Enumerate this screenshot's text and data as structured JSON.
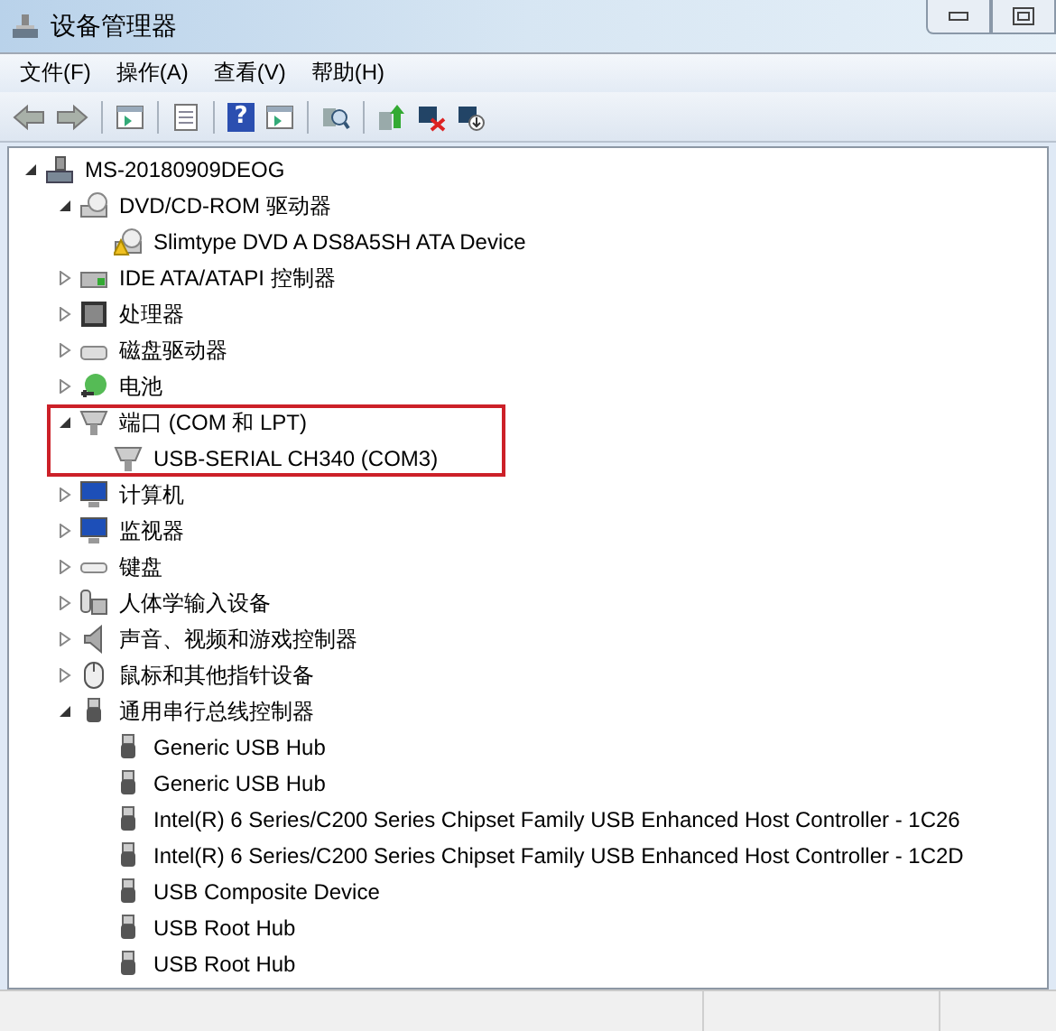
{
  "window": {
    "title": "设备管理器"
  },
  "menu": [
    {
      "label": "文件(F)"
    },
    {
      "label": "操作(A)"
    },
    {
      "label": "查看(V)"
    },
    {
      "label": "帮助(H)"
    }
  ],
  "toolbar": [
    {
      "kind": "back"
    },
    {
      "kind": "forward"
    },
    {
      "kind": "separator"
    },
    {
      "kind": "console-tree"
    },
    {
      "kind": "separator"
    },
    {
      "kind": "properties"
    },
    {
      "kind": "separator"
    },
    {
      "kind": "help",
      "glyph": "?"
    },
    {
      "kind": "action-pane"
    },
    {
      "kind": "separator"
    },
    {
      "kind": "scan"
    },
    {
      "kind": "separator"
    },
    {
      "kind": "update"
    },
    {
      "kind": "disable"
    },
    {
      "kind": "uninstall"
    }
  ],
  "tree": {
    "label": "MS-20180909DEOG",
    "kind": "computer",
    "expanded": true,
    "children": [
      {
        "label": "DVD/CD-ROM 驱动器",
        "kind": "dvd",
        "expanded": true,
        "children": [
          {
            "label": "Slimtype DVD A  DS8A5SH ATA Device",
            "kind": "dvd-warning"
          }
        ]
      },
      {
        "label": "IDE ATA/ATAPI 控制器",
        "kind": "ide",
        "expanded": false
      },
      {
        "label": "处理器",
        "kind": "cpu",
        "expanded": false
      },
      {
        "label": "磁盘驱动器",
        "kind": "disk",
        "expanded": false
      },
      {
        "label": "电池",
        "kind": "battery",
        "expanded": false
      },
      {
        "label": "端口 (COM 和 LPT)",
        "kind": "port",
        "expanded": true,
        "highlight": true,
        "children": [
          {
            "label": "USB-SERIAL CH340 (COM3)",
            "kind": "port"
          }
        ]
      },
      {
        "label": "计算机",
        "kind": "monitor",
        "expanded": false
      },
      {
        "label": "监视器",
        "kind": "monitor",
        "expanded": false
      },
      {
        "label": "键盘",
        "kind": "keyboard",
        "expanded": false
      },
      {
        "label": "人体学输入设备",
        "kind": "hid",
        "expanded": false
      },
      {
        "label": "声音、视频和游戏控制器",
        "kind": "sound",
        "expanded": false
      },
      {
        "label": "鼠标和其他指针设备",
        "kind": "mouse",
        "expanded": false
      },
      {
        "label": "通用串行总线控制器",
        "kind": "usb",
        "expanded": true,
        "children": [
          {
            "label": "Generic USB Hub",
            "kind": "usb"
          },
          {
            "label": "Generic USB Hub",
            "kind": "usb"
          },
          {
            "label": "Intel(R) 6 Series/C200 Series Chipset Family USB Enhanced Host Controller - 1C26",
            "kind": "usb"
          },
          {
            "label": "Intel(R) 6 Series/C200 Series Chipset Family USB Enhanced Host Controller - 1C2D",
            "kind": "usb"
          },
          {
            "label": "USB Composite Device",
            "kind": "usb"
          },
          {
            "label": "USB Root Hub",
            "kind": "usb"
          },
          {
            "label": "USB Root Hub",
            "kind": "usb"
          }
        ]
      }
    ]
  }
}
